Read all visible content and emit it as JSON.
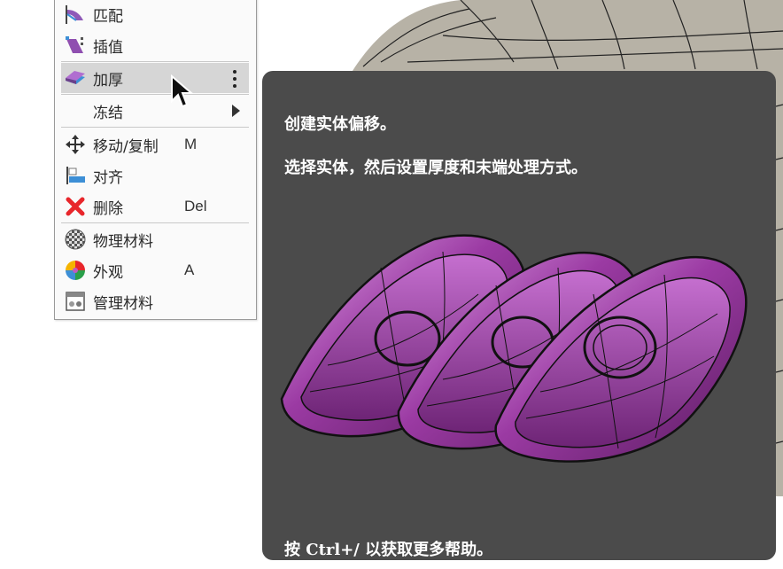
{
  "menu": {
    "items": [
      {
        "label": "匹配",
        "shortcut": "",
        "icon": "match-icon"
      },
      {
        "label": "插值",
        "shortcut": "",
        "icon": "interpolate-icon"
      },
      {
        "label": "加厚",
        "shortcut": "",
        "icon": "thicken-icon"
      },
      {
        "label": "冻结",
        "shortcut": "",
        "icon": ""
      },
      {
        "label": "移动/复制",
        "shortcut": "M",
        "icon": "move-icon"
      },
      {
        "label": "对齐",
        "shortcut": "",
        "icon": "align-icon"
      },
      {
        "label": "删除",
        "shortcut": "Del",
        "icon": "delete-icon"
      },
      {
        "label": "物理材料",
        "shortcut": "",
        "icon": "physical-material-icon"
      },
      {
        "label": "外观",
        "shortcut": "A",
        "icon": "appearance-icon"
      },
      {
        "label": "管理材料",
        "shortcut": "",
        "icon": "manage-materials-icon"
      }
    ]
  },
  "tooltip": {
    "title": "创建实体偏移。",
    "description": "选择实体，然后设置厚度和末端处理方式。",
    "help": "按 Ctrl+/ 以获取更多帮助。"
  },
  "colors": {
    "tooltip_bg": "#4b4b4b",
    "hover_bg": "#d6d6d6",
    "delete_red": "#e8262b",
    "accent_blue": "#3d8fd6",
    "shape_magenta": "#a24fa6"
  }
}
